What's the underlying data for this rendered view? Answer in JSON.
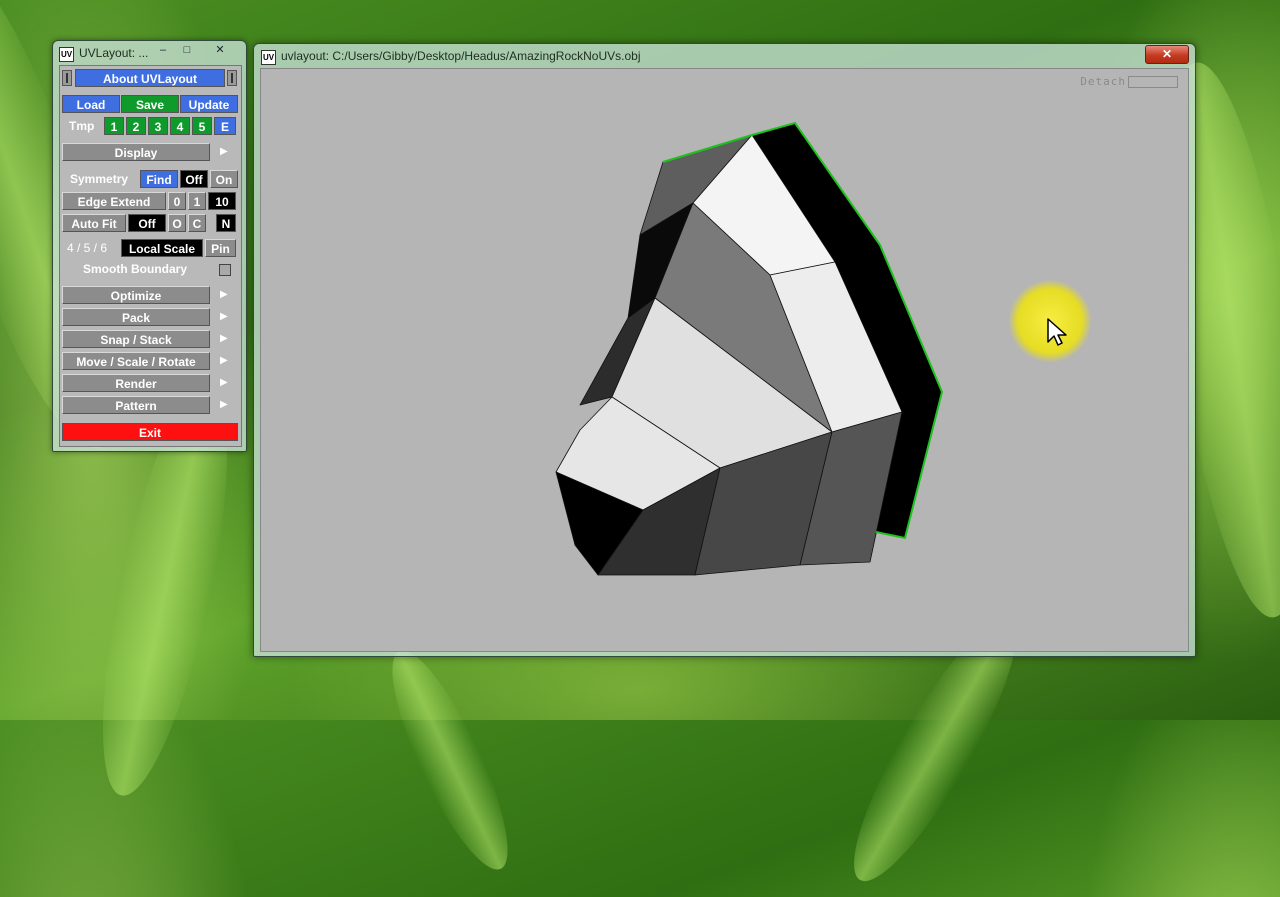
{
  "panel": {
    "title": "UVLayout: ...",
    "logo": "UV",
    "window_controls": [
      "–",
      "□",
      "✕"
    ],
    "about_label": "About UVLayout",
    "load_label": "Load",
    "save_label": "Save",
    "update_label": "Update",
    "tmp_label": "Tmp",
    "tmp_slots": [
      "1",
      "2",
      "3",
      "4",
      "5",
      "E"
    ],
    "display_label": "Display",
    "symmetry": {
      "label": "Symmetry",
      "find": "Find",
      "off": "Off",
      "on": "On"
    },
    "edge_extend": {
      "label": "Edge Extend",
      "v0": "0",
      "v1": "1",
      "v10": "10"
    },
    "auto_fit": {
      "label": "Auto Fit",
      "off": "Off",
      "o": "O",
      "c": "C",
      "n": "N"
    },
    "scale_keys": "4 / 5 / 6",
    "local_scale_label": "Local Scale",
    "pin_label": "Pin",
    "smooth_boundary_label": "Smooth Boundary",
    "optimize_label": "Optimize",
    "pack_label": "Pack",
    "snap_stack_label": "Snap / Stack",
    "move_scale_rotate_label": "Move / Scale / Rotate",
    "render_label": "Render",
    "pattern_label": "Pattern",
    "exit_label": "Exit",
    "submenu_arrow": "▶"
  },
  "viewport": {
    "title": "uvlayout: C:/Users/Gibby/Desktop/Headus/AmazingRockNoUVs.obj",
    "close_glyph": "✕",
    "detach_label": "Detach"
  },
  "colors": {
    "button_blue": "#3f6ee0",
    "button_green": "#0f9a2c",
    "exit_red": "#ff1010",
    "viewport_bg": "#b5b5b5",
    "cursor_highlight": "#f2e61c"
  }
}
